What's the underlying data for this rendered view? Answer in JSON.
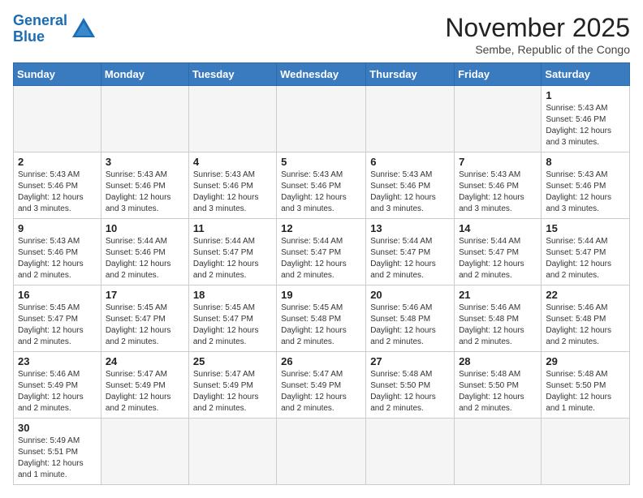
{
  "logo": {
    "line1": "General",
    "line2": "Blue"
  },
  "title": "November 2025",
  "subtitle": "Sembe, Republic of the Congo",
  "days_of_week": [
    "Sunday",
    "Monday",
    "Tuesday",
    "Wednesday",
    "Thursday",
    "Friday",
    "Saturday"
  ],
  "weeks": [
    [
      {
        "day": "",
        "info": ""
      },
      {
        "day": "",
        "info": ""
      },
      {
        "day": "",
        "info": ""
      },
      {
        "day": "",
        "info": ""
      },
      {
        "day": "",
        "info": ""
      },
      {
        "day": "",
        "info": ""
      },
      {
        "day": "1",
        "info": "Sunrise: 5:43 AM\nSunset: 5:46 PM\nDaylight: 12 hours and 3 minutes."
      }
    ],
    [
      {
        "day": "2",
        "info": "Sunrise: 5:43 AM\nSunset: 5:46 PM\nDaylight: 12 hours and 3 minutes."
      },
      {
        "day": "3",
        "info": "Sunrise: 5:43 AM\nSunset: 5:46 PM\nDaylight: 12 hours and 3 minutes."
      },
      {
        "day": "4",
        "info": "Sunrise: 5:43 AM\nSunset: 5:46 PM\nDaylight: 12 hours and 3 minutes."
      },
      {
        "day": "5",
        "info": "Sunrise: 5:43 AM\nSunset: 5:46 PM\nDaylight: 12 hours and 3 minutes."
      },
      {
        "day": "6",
        "info": "Sunrise: 5:43 AM\nSunset: 5:46 PM\nDaylight: 12 hours and 3 minutes."
      },
      {
        "day": "7",
        "info": "Sunrise: 5:43 AM\nSunset: 5:46 PM\nDaylight: 12 hours and 3 minutes."
      },
      {
        "day": "8",
        "info": "Sunrise: 5:43 AM\nSunset: 5:46 PM\nDaylight: 12 hours and 3 minutes."
      }
    ],
    [
      {
        "day": "9",
        "info": "Sunrise: 5:43 AM\nSunset: 5:46 PM\nDaylight: 12 hours and 2 minutes."
      },
      {
        "day": "10",
        "info": "Sunrise: 5:44 AM\nSunset: 5:46 PM\nDaylight: 12 hours and 2 minutes."
      },
      {
        "day": "11",
        "info": "Sunrise: 5:44 AM\nSunset: 5:47 PM\nDaylight: 12 hours and 2 minutes."
      },
      {
        "day": "12",
        "info": "Sunrise: 5:44 AM\nSunset: 5:47 PM\nDaylight: 12 hours and 2 minutes."
      },
      {
        "day": "13",
        "info": "Sunrise: 5:44 AM\nSunset: 5:47 PM\nDaylight: 12 hours and 2 minutes."
      },
      {
        "day": "14",
        "info": "Sunrise: 5:44 AM\nSunset: 5:47 PM\nDaylight: 12 hours and 2 minutes."
      },
      {
        "day": "15",
        "info": "Sunrise: 5:44 AM\nSunset: 5:47 PM\nDaylight: 12 hours and 2 minutes."
      }
    ],
    [
      {
        "day": "16",
        "info": "Sunrise: 5:45 AM\nSunset: 5:47 PM\nDaylight: 12 hours and 2 minutes."
      },
      {
        "day": "17",
        "info": "Sunrise: 5:45 AM\nSunset: 5:47 PM\nDaylight: 12 hours and 2 minutes."
      },
      {
        "day": "18",
        "info": "Sunrise: 5:45 AM\nSunset: 5:47 PM\nDaylight: 12 hours and 2 minutes."
      },
      {
        "day": "19",
        "info": "Sunrise: 5:45 AM\nSunset: 5:48 PM\nDaylight: 12 hours and 2 minutes."
      },
      {
        "day": "20",
        "info": "Sunrise: 5:46 AM\nSunset: 5:48 PM\nDaylight: 12 hours and 2 minutes."
      },
      {
        "day": "21",
        "info": "Sunrise: 5:46 AM\nSunset: 5:48 PM\nDaylight: 12 hours and 2 minutes."
      },
      {
        "day": "22",
        "info": "Sunrise: 5:46 AM\nSunset: 5:48 PM\nDaylight: 12 hours and 2 minutes."
      }
    ],
    [
      {
        "day": "23",
        "info": "Sunrise: 5:46 AM\nSunset: 5:49 PM\nDaylight: 12 hours and 2 minutes."
      },
      {
        "day": "24",
        "info": "Sunrise: 5:47 AM\nSunset: 5:49 PM\nDaylight: 12 hours and 2 minutes."
      },
      {
        "day": "25",
        "info": "Sunrise: 5:47 AM\nSunset: 5:49 PM\nDaylight: 12 hours and 2 minutes."
      },
      {
        "day": "26",
        "info": "Sunrise: 5:47 AM\nSunset: 5:49 PM\nDaylight: 12 hours and 2 minutes."
      },
      {
        "day": "27",
        "info": "Sunrise: 5:48 AM\nSunset: 5:50 PM\nDaylight: 12 hours and 2 minutes."
      },
      {
        "day": "28",
        "info": "Sunrise: 5:48 AM\nSunset: 5:50 PM\nDaylight: 12 hours and 2 minutes."
      },
      {
        "day": "29",
        "info": "Sunrise: 5:48 AM\nSunset: 5:50 PM\nDaylight: 12 hours and 1 minute."
      }
    ],
    [
      {
        "day": "30",
        "info": "Sunrise: 5:49 AM\nSunset: 5:51 PM\nDaylight: 12 hours and 1 minute."
      },
      {
        "day": "",
        "info": ""
      },
      {
        "day": "",
        "info": ""
      },
      {
        "day": "",
        "info": ""
      },
      {
        "day": "",
        "info": ""
      },
      {
        "day": "",
        "info": ""
      },
      {
        "day": "",
        "info": ""
      }
    ]
  ]
}
